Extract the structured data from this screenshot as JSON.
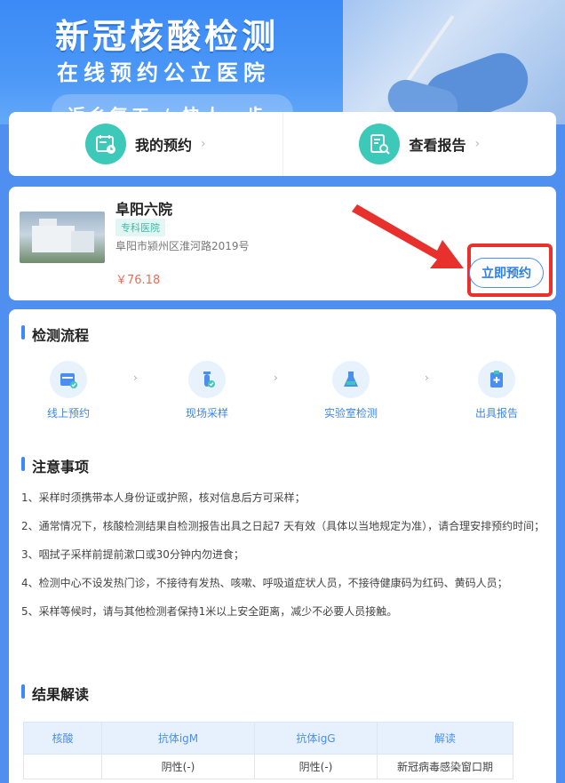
{
  "banner": {
    "title": "新冠核酸检测",
    "subtitle": "在线预约公立医院",
    "slogan": "返乡复工 / 快人一步"
  },
  "quick_actions": [
    {
      "label": "我的预约",
      "icon": "calendar-clock-icon"
    },
    {
      "label": "查看报告",
      "icon": "report-search-icon"
    }
  ],
  "hospital": {
    "name": "阜阳六院",
    "tag": "专科医院",
    "address": "阜阳市颍州区淮河路2019号",
    "price": "￥76.18",
    "book_label": "立即预约"
  },
  "process": {
    "title": "检测流程",
    "steps": [
      {
        "label": "线上预约",
        "icon": "calendar-check-icon"
      },
      {
        "label": "现场采样",
        "icon": "test-tube-icon"
      },
      {
        "label": "实验室检测",
        "icon": "flask-icon"
      },
      {
        "label": "出具报告",
        "icon": "clipboard-icon"
      }
    ]
  },
  "notice": {
    "title": "注意事项",
    "items": [
      "1、采样时须携带本人身份证或护照，核对信息后方可采样；",
      "2、通常情况下，核酸检测结果自检测报告出具之日起7 天有效（具体以当地规定为准），请合理安排预约时间；",
      "3、咽拭子采样前提前漱口或30分钟内勿进食；",
      "4、检测中心不设发热门诊，不接待有发热、咳嗽、呼吸道症状人员，不接待健康码为红码、黄码人员；",
      "5、采样等候时，请与其他检测者保持1米以上安全距离，减少不必要人员接触。"
    ]
  },
  "results": {
    "title": "结果解读",
    "headers": [
      "核酸",
      "抗体igM",
      "抗体igG",
      "解读"
    ],
    "rows": [
      [
        "",
        "阴性(-)",
        "阴性(-)",
        "新冠病毒感染窗口期"
      ]
    ]
  },
  "colors": {
    "brand_blue": "#3b8af6",
    "teal": "#3dc9b9",
    "highlight_red": "#e8302c",
    "price_red": "#f06a5a"
  }
}
